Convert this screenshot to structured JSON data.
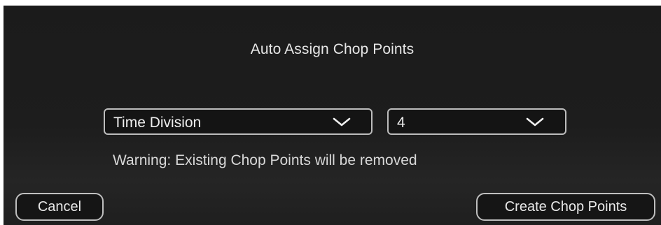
{
  "dialog": {
    "title": "Auto Assign Chop Points",
    "mode_select": {
      "selected": "Time Division",
      "icon": "chevron-down-icon"
    },
    "count_select": {
      "selected": "4",
      "icon": "chevron-down-icon"
    },
    "warning": "Warning: Existing Chop Points will be removed",
    "buttons": {
      "cancel_label": "Cancel",
      "create_label": "Create Chop Points"
    }
  },
  "colors": {
    "background": "#1b1b1b",
    "border": "#bdbdbd",
    "text": "#e6e6e6"
  }
}
